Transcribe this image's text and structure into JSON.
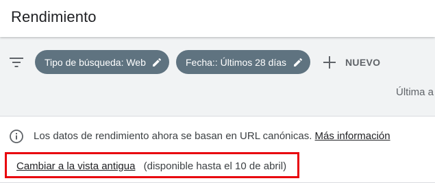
{
  "header": {
    "title": "Rendimiento"
  },
  "filters": {
    "filter_icon": "filter-list-icon",
    "chips": [
      {
        "label": "Tipo de búsqueda: Web",
        "icon": "edit-pencil-icon"
      },
      {
        "label": "Fecha:: Últimos 28 días",
        "icon": "edit-pencil-icon"
      }
    ],
    "new_button": {
      "label": "NUEVO",
      "icon": "plus-icon"
    },
    "last_update_partial": "Última a"
  },
  "notice": {
    "icon": "info-icon",
    "text": "Los datos de rendimiento ahora se basan en URL canónicas.",
    "more_info_link": "Más información",
    "old_view_link": "Cambiar a la vista antigua",
    "availability": "(disponible hasta el 10 de abril)"
  },
  "colors": {
    "chip_background": "#5f7380",
    "highlight_border": "#e8000b",
    "header_background": "#ffffff",
    "page_background": "#f1f3f4"
  }
}
